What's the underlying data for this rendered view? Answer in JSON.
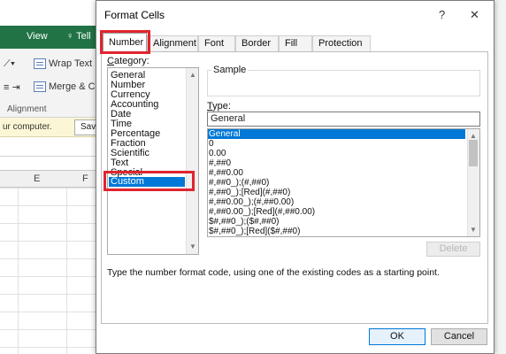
{
  "excel": {
    "tabs": {
      "view": "View",
      "tell_me": "Tell"
    },
    "ribbon": {
      "wrap_text": "Wrap Text",
      "merge_center": "Merge & Ce",
      "group_label": "Alignment"
    },
    "message_bar": {
      "text": "ur computer.",
      "button": "Sav"
    },
    "columns": [
      "E",
      "F"
    ],
    "colors": {
      "ribbon_green": "#217346"
    }
  },
  "dialog": {
    "title": "Format Cells",
    "help_icon_glyph": "?",
    "close_icon_glyph": "✕",
    "tabs": [
      {
        "label": "Number",
        "active": true
      },
      {
        "label": "Alignment"
      },
      {
        "label": "Font"
      },
      {
        "label": "Border"
      },
      {
        "label": "Fill"
      },
      {
        "label": "Protection"
      }
    ],
    "category": {
      "label_underlined": "C",
      "label_rest": "ategory:",
      "items": [
        "General",
        "Number",
        "Currency",
        "Accounting",
        "Date",
        "Time",
        "Percentage",
        "Fraction",
        "Scientific",
        "Text",
        "Special",
        "Custom"
      ],
      "selected": "Custom"
    },
    "sample": {
      "label": "Sample",
      "value": ""
    },
    "type": {
      "label_underlined": "T",
      "label_rest": "ype:",
      "value": "General",
      "items": [
        "General",
        "0",
        "0.00",
        "#,##0",
        "#,##0.00",
        "#,##0_);(#,##0)",
        "#,##0_);[Red](#,##0)",
        "#,##0.00_);(#,##0.00)",
        "#,##0.00_);[Red](#,##0.00)",
        "$#,##0_);($#,##0)",
        "$#,##0_);[Red]($#,##0)"
      ],
      "selected": "General"
    },
    "delete_button": "Delete",
    "hint": "Type the number format code, using one of the existing codes as a starting point.",
    "ok_button": "OK",
    "cancel_button": "Cancel",
    "colors": {
      "highlight": "#e0252f",
      "selection": "#0078d7"
    }
  }
}
